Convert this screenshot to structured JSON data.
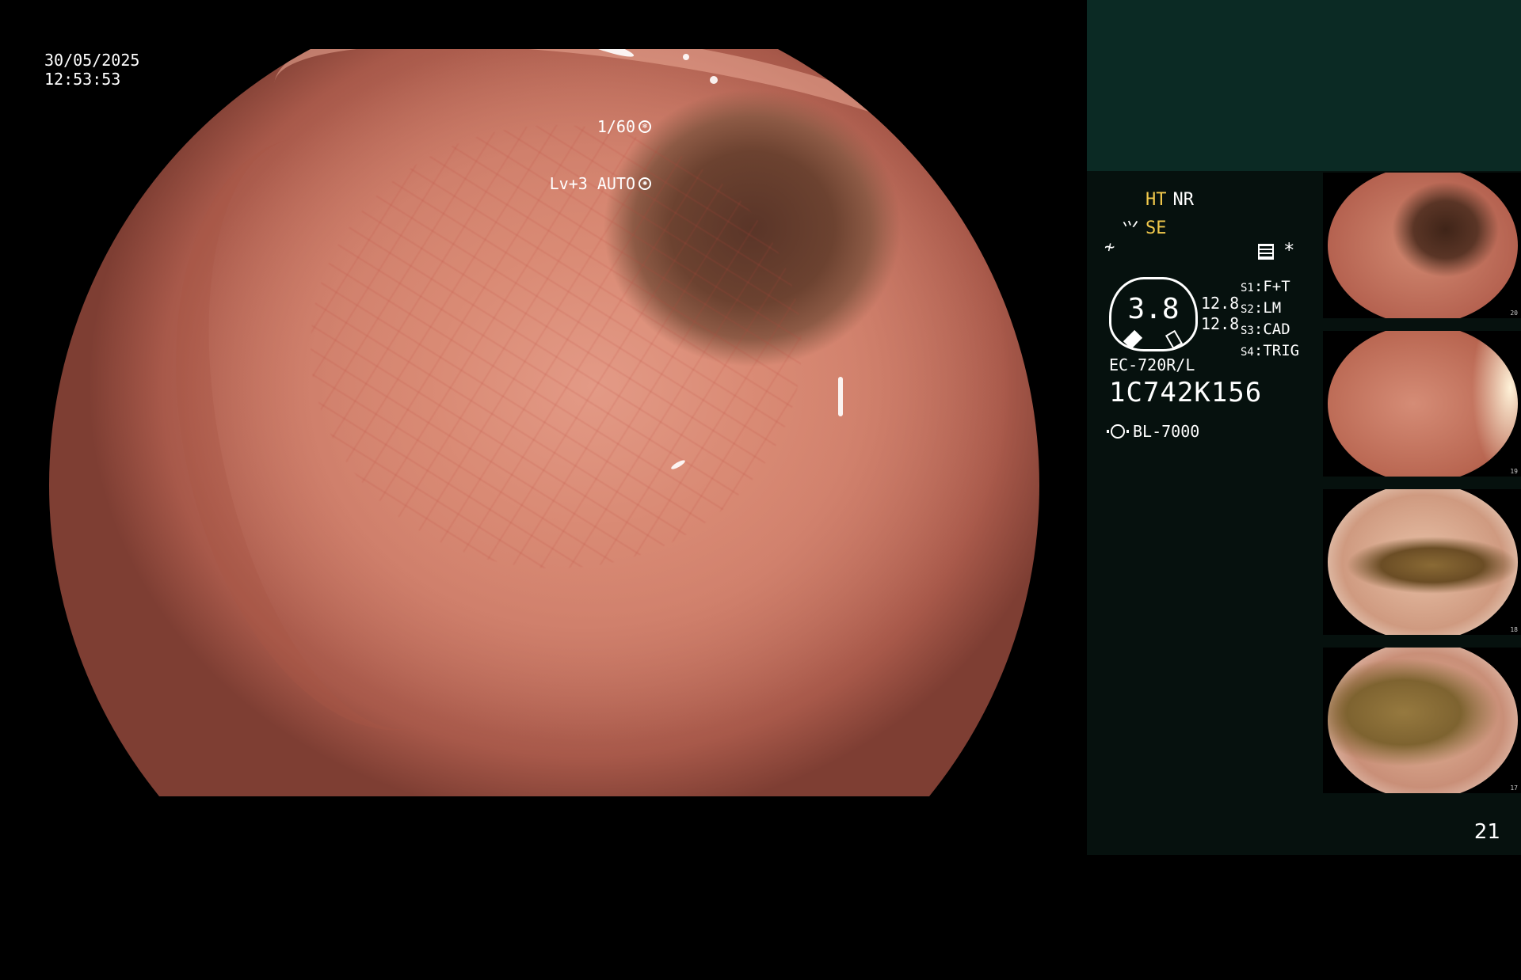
{
  "overlay": {
    "date": "30/05/2025",
    "time": "12:53:53",
    "shutter": "1/60",
    "level_mode": "Lv+3 AUTO"
  },
  "status": {
    "ht": "HT",
    "nr": "NR",
    "se": "SE",
    "gauge_value": "3.8",
    "gauge_right_top": "12.8",
    "gauge_right_bottom": "12.8",
    "switches": [
      {
        "key": "S1",
        "value": "F+T"
      },
      {
        "key": "S2",
        "value": "LM"
      },
      {
        "key": "S3",
        "value": "CAD"
      },
      {
        "key": "S4",
        "value": "TRIG"
      }
    ],
    "asterisk": "*",
    "model": "EC-720R/L",
    "serial": "1C742K156",
    "light_source": "BL-7000"
  },
  "thumbnails": [
    {
      "index": "20"
    },
    {
      "index": "19"
    },
    {
      "index": "18"
    },
    {
      "index": "17"
    }
  ],
  "page_number": "21",
  "colors": {
    "panel_background": "#06110e",
    "panel_header": "#0b2a24",
    "accent_yellow": "#f2c94c"
  }
}
